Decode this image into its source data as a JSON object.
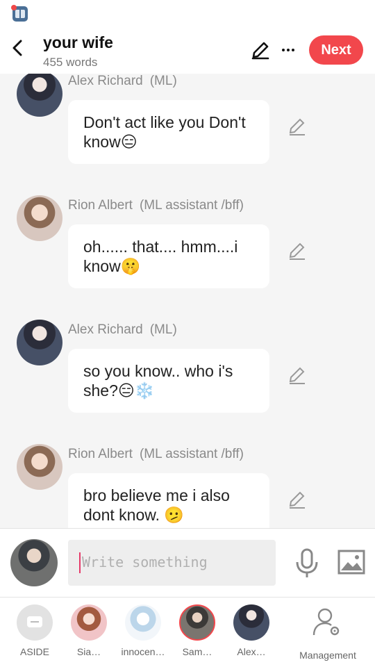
{
  "header": {
    "title": "your wife",
    "word_count": "455 words",
    "next_label": "Next"
  },
  "messages": [
    {
      "sender": "Alex Richard",
      "role": "(ML)",
      "text": "Don't act like you Don't know😑",
      "avatar": "alex-avatar"
    },
    {
      "sender": "Rion Albert",
      "role": "(ML assistant /bff)",
      "text": "oh......  that.... hmm....i know🤫",
      "avatar": "rion-avatar"
    },
    {
      "sender": "Alex Richard",
      "role": "(ML)",
      "text": "so you know.. who i's she?😑❄️",
      "avatar": "alex-avatar"
    },
    {
      "sender": "Rion Albert",
      "role": "(ML assistant /bff)",
      "text": "bro believe me i also dont know.  🫤",
      "avatar": "rion-avatar"
    }
  ],
  "composer": {
    "placeholder": "Write something"
  },
  "bottom_nav": [
    {
      "label": "ASIDE"
    },
    {
      "label": "Sia…"
    },
    {
      "label": "innocen…"
    },
    {
      "label": "Sam…"
    },
    {
      "label": "Alex…"
    },
    {
      "label": "Management"
    }
  ],
  "colors": {
    "accent": "#f2474c",
    "background": "#f5f5f5",
    "bubble": "#ffffff",
    "sender_text": "#8a8a8a"
  },
  "icons": [
    "app-icon",
    "back-icon",
    "pencil-icon",
    "more-icon",
    "edit-message-icon",
    "mic-icon",
    "image-icon",
    "aside-icon",
    "management-icon"
  ]
}
